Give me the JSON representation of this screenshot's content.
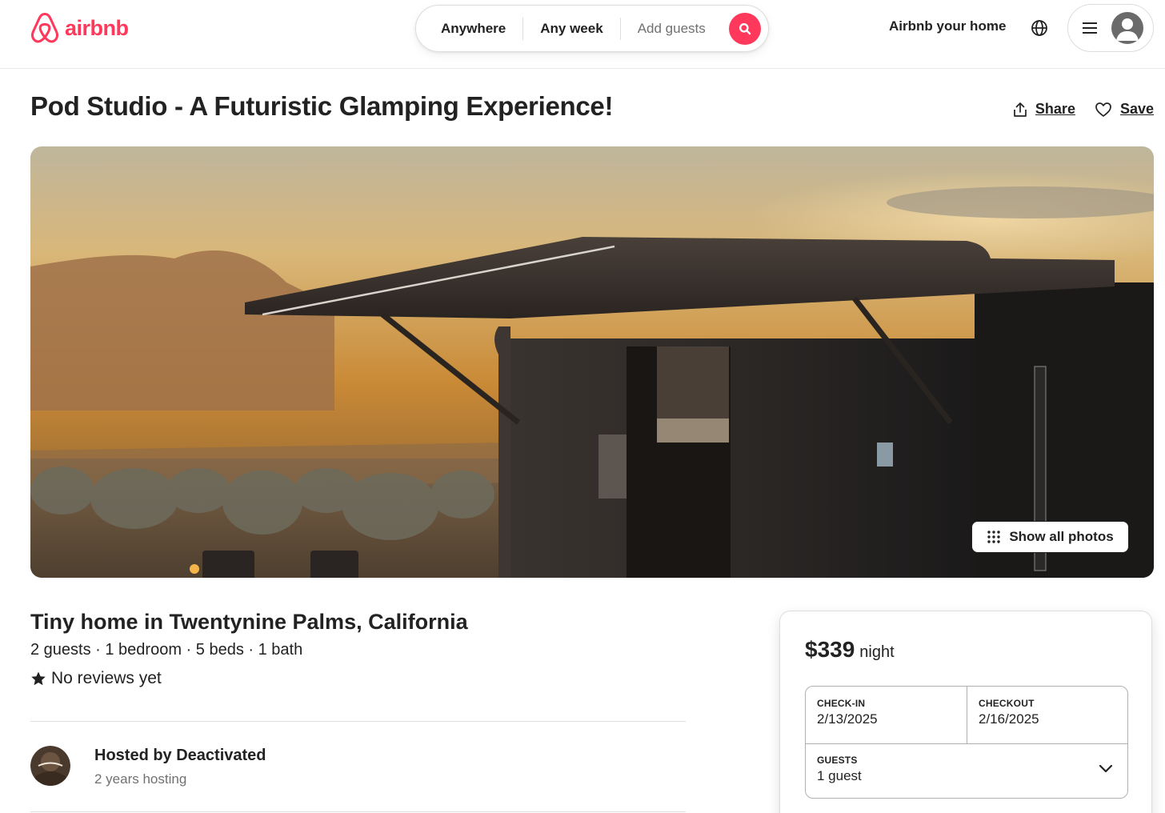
{
  "brand": {
    "name": "airbnb",
    "color": "#FF385C"
  },
  "search": {
    "where": "Anywhere",
    "when": "Any week",
    "who": "Add guests",
    "icon": "search-icon"
  },
  "nav": {
    "host_link": "Airbnb your home",
    "globe_icon": "globe-icon",
    "menu_icon": "hamburger-icon",
    "avatar_icon": "user-avatar-icon"
  },
  "listing": {
    "title": "Pod Studio - A Futuristic Glamping Experience!",
    "share": "Share",
    "save": "Save",
    "show_photos": "Show all photos",
    "type_location": "Tiny home in Twentynine Palms, California",
    "details": "2 guests · 1 bedroom · 5 beds · 1 bath",
    "reviews": "No reviews yet"
  },
  "host": {
    "name": "Hosted by Deactivated",
    "years": "2 years hosting"
  },
  "booking": {
    "price": "$339",
    "unit": "night",
    "checkin_label": "CHECK-IN",
    "checkin_value": "2/13/2025",
    "checkout_label": "CHECKOUT",
    "checkout_value": "2/16/2025",
    "guests_label": "GUESTS",
    "guests_value": "1 guest"
  }
}
